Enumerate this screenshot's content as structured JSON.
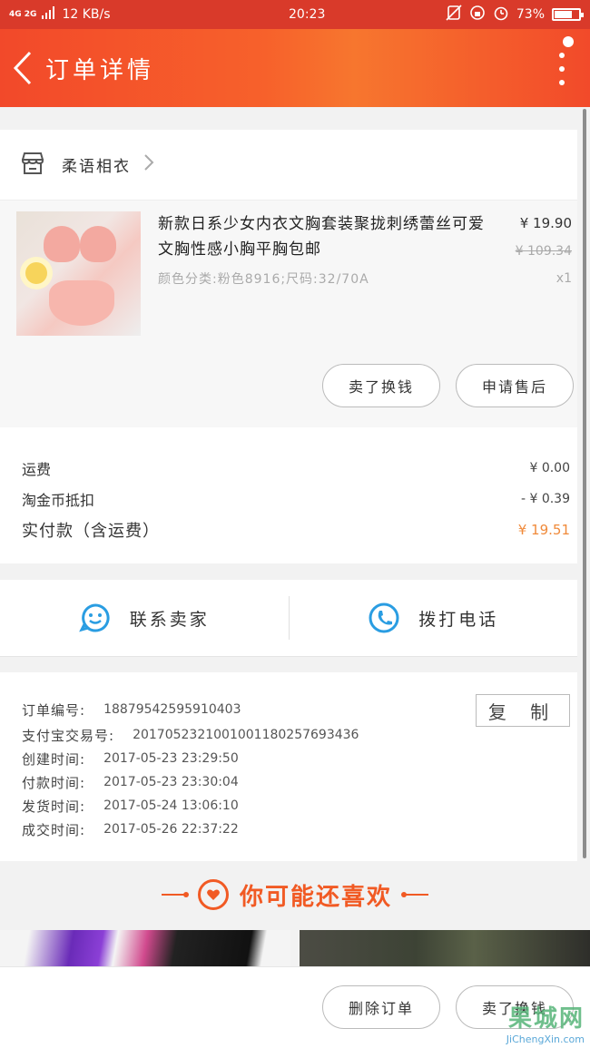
{
  "status_bar": {
    "network": "4G 2G",
    "speed": "12 KB/s",
    "time": "20:23",
    "battery": "73%",
    "battery_level": 0.73
  },
  "header": {
    "title": "订单详情"
  },
  "shop": {
    "name": "柔语相衣"
  },
  "product": {
    "title": "新款日系少女内衣文胸套装聚拢刺绣蕾丝可爱文胸性感小胸平胸包邮",
    "sku": "颜色分类:粉色8916;尺码:32/70A",
    "price": "¥ 19.90",
    "original_price": "¥ 109.34",
    "quantity": "x1",
    "buttons": {
      "buy_again": "卖了换钱",
      "after_sale": "申请售后"
    }
  },
  "fees": {
    "shipping_label": "运费",
    "shipping_value": "¥ 0.00",
    "coin_label": "淘金币抵扣",
    "coin_value": "- ¥ 0.39",
    "total_label": "实付款（含运费）",
    "total_value": "¥ 19.51",
    "accent_color": "#f08a3a"
  },
  "contact": {
    "seller": "联系卖家",
    "phone": "拨打电话"
  },
  "order_info": {
    "copy_label": "复 制",
    "rows": [
      {
        "label": "订单编号:",
        "value": "18879542595910403"
      },
      {
        "label": "支付宝交易号:",
        "value": "2017052321001001180257693436"
      },
      {
        "label": "创建时间:",
        "value": "2017-05-23 23:29:50"
      },
      {
        "label": "付款时间:",
        "value": "2017-05-23 23:30:04"
      },
      {
        "label": "发货时间:",
        "value": "2017-05-24 13:06:10"
      },
      {
        "label": "成交时间:",
        "value": "2017-05-26 22:37:22"
      }
    ]
  },
  "recommend": {
    "title": "你可能还喜欢",
    "color": "#f15a24"
  },
  "bottom_bar": {
    "delete_order": "删除订单",
    "sell_for_cash": "卖了换钱"
  },
  "watermark": {
    "line1": "果城网",
    "line2": "JiChengXin.com"
  }
}
